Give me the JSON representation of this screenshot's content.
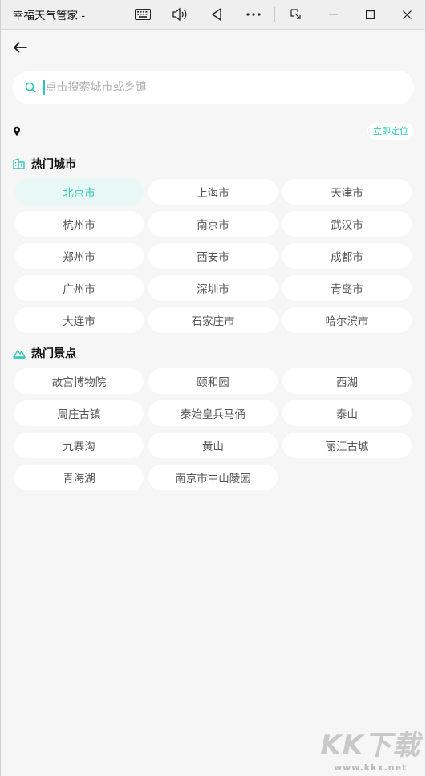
{
  "window": {
    "title": "幸福天气管家 -"
  },
  "search": {
    "placeholder": "点击搜索城市或乡镇"
  },
  "location": {
    "locate_label": "立即定位"
  },
  "hot_cities": {
    "title": "热门城市",
    "items": [
      "北京市",
      "上海市",
      "天津市",
      "杭州市",
      "南京市",
      "武汉市",
      "郑州市",
      "西安市",
      "成都市",
      "广州市",
      "深圳市",
      "青岛市",
      "大连市",
      "石家庄市",
      "哈尔滨市"
    ],
    "selected": "北京市"
  },
  "hot_spots": {
    "title": "热门景点",
    "items": [
      "故宫博物院",
      "颐和园",
      "西湖",
      "周庄古镇",
      "秦始皇兵马俑",
      "泰山",
      "九寨沟",
      "黄山",
      "丽江古城",
      "青海湖",
      "南京市中山陵园"
    ]
  },
  "watermark": {
    "main": "KK下载",
    "sub": "www.kkx.net"
  },
  "colors": {
    "accent": "#2ec7b5",
    "chip_bg": "#ffffff",
    "page_bg": "#f6f6f6"
  }
}
